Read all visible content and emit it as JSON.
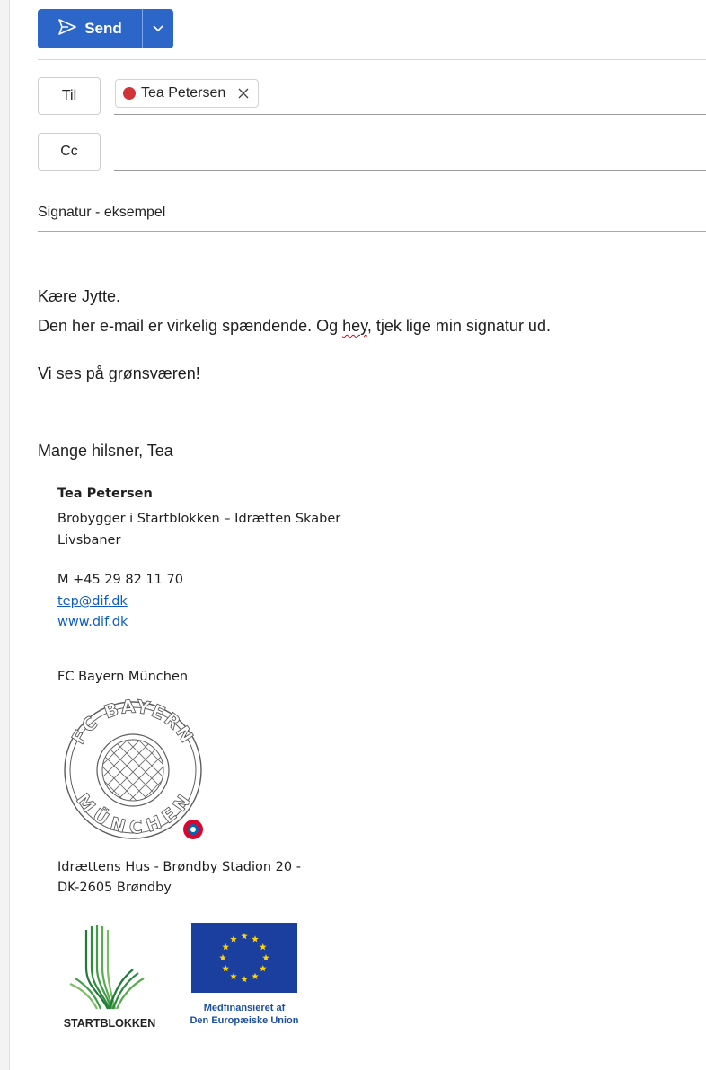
{
  "toolbar": {
    "send_label": "Send"
  },
  "recipients": {
    "to_label": "Til",
    "to_chip": "Tea Petersen",
    "cc_label": "Cc"
  },
  "subject": "Signatur - eksempel",
  "body": {
    "greeting": "Kære Jytte.",
    "line1_before": "Den her e-mail er virkelig spændende. Og ",
    "line1_misspelled": "hey",
    "line1_after": ", tjek lige min signatur ud.",
    "line2": "Vi ses på grønsværen!",
    "closing": "Mange hilsner, Tea"
  },
  "signature": {
    "name": "Tea Petersen",
    "title_line1": "Brobygger i Startblokken – Idrætten Skaber",
    "title_line2": "Livsbaner",
    "phone": "M +45 29 82 11 70",
    "email": "tep@dif.dk",
    "website": "www.dif.dk",
    "club": "FC Bayern München",
    "crest_text_top": "FC BAYERN",
    "crest_text_bottom": "MÜNCHEN",
    "address_line1": "Idrættens Hus - Brøndby Stadion 20 -",
    "address_line2": "DK-2605 Brøndby",
    "logo1_text": "STARTBLOKKEN",
    "logo2_text_line1": "Medfinansieret af",
    "logo2_text_line2": "Den Europæiske Union"
  },
  "colors": {
    "send_button": "#2b66c8",
    "recipient_dot": "#d13438",
    "link": "#0f5cc0",
    "eu_blue": "#1b3f9e",
    "eu_star": "#ffd400",
    "startblokken_green": "#2e8b3e"
  }
}
